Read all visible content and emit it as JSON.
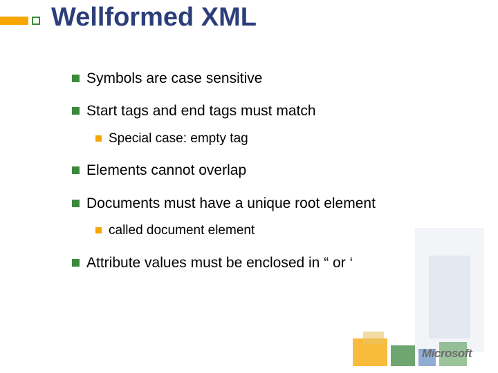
{
  "title": "Wellformed XML",
  "bullets": {
    "b1": "Symbols are case sensitive",
    "b2": "Start tags and end tags must match",
    "b2_1": "Special case: empty tag",
    "b3": "Elements cannot overlap",
    "b4": "Documents must have a unique root element",
    "b4_1": "called document element",
    "b5": "Attribute values must be enclosed in “ or ‘"
  },
  "logo": "Microsoft"
}
